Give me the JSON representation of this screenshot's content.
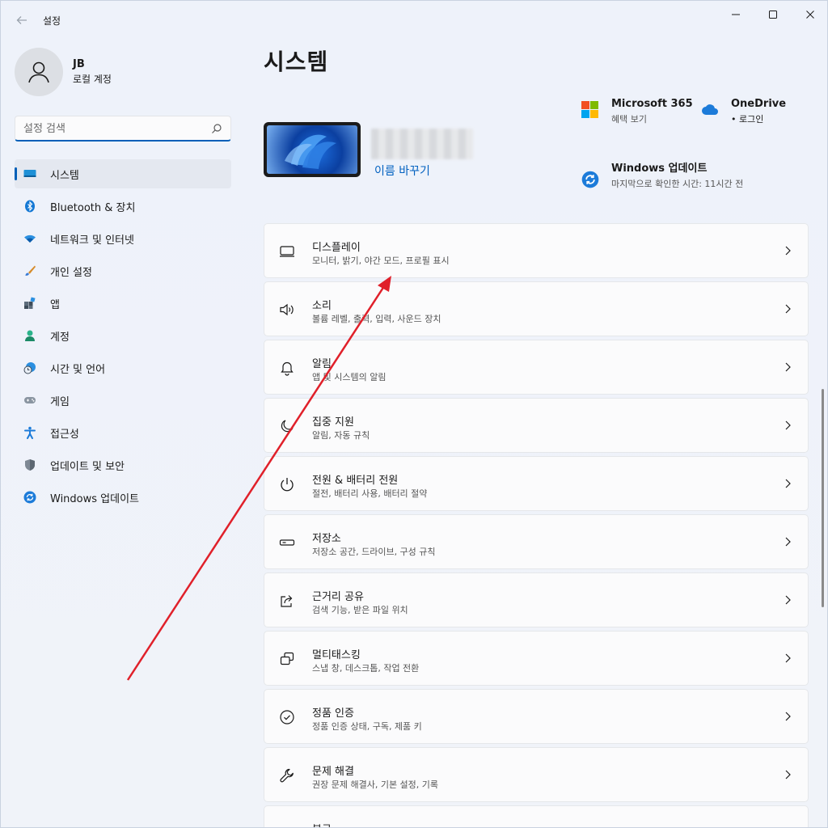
{
  "app": {
    "title": "설정"
  },
  "profile": {
    "name": "JB",
    "account_type": "로컬 계정"
  },
  "search": {
    "placeholder": "설정 검색"
  },
  "sidebar": {
    "items": [
      {
        "label": "시스템",
        "icon": "monitor-icon",
        "active": true
      },
      {
        "label": "Bluetooth & 장치",
        "icon": "bluetooth-icon"
      },
      {
        "label": "네트워크 및 인터넷",
        "icon": "wifi-icon"
      },
      {
        "label": "개인 설정",
        "icon": "brush-icon"
      },
      {
        "label": "앱",
        "icon": "apps-icon"
      },
      {
        "label": "계정",
        "icon": "person-icon"
      },
      {
        "label": "시간 및 언어",
        "icon": "clock-globe-icon"
      },
      {
        "label": "게임",
        "icon": "gamepad-icon"
      },
      {
        "label": "접근성",
        "icon": "accessibility-icon"
      },
      {
        "label": "업데이트 및 보안",
        "icon": "shield-icon"
      },
      {
        "label": "Windows 업데이트",
        "icon": "windows-update-icon"
      }
    ]
  },
  "main": {
    "title": "시스템",
    "rename_label": "이름 바꾸기",
    "quick": {
      "m365": {
        "title": "Microsoft 365",
        "sub": "혜택 보기"
      },
      "onedrive": {
        "title": "OneDrive",
        "sub": "• 로그인"
      },
      "update": {
        "title": "Windows 업데이트",
        "sub": "마지막으로 확인한 시간: 11시간 전"
      }
    },
    "cards": [
      {
        "title": "디스플레이",
        "sub": "모니터, 밝기, 야간 모드, 프로필 표시",
        "icon": "display-icon"
      },
      {
        "title": "소리",
        "sub": "볼륨 레벨, 출력, 입력, 사운드 장치",
        "icon": "speaker-icon"
      },
      {
        "title": "알림",
        "sub": "앱 및 시스템의 알림",
        "icon": "bell-icon"
      },
      {
        "title": "집중 지원",
        "sub": "알림, 자동 규칙",
        "icon": "moon-icon"
      },
      {
        "title": "전원 & 배터리 전원",
        "sub": "절전, 배터리 사용, 배터리 절약",
        "icon": "power-icon"
      },
      {
        "title": "저장소",
        "sub": "저장소 공간, 드라이브, 구성 규칙",
        "icon": "storage-icon"
      },
      {
        "title": "근거리 공유",
        "sub": "검색 기능, 받은 파일 위치",
        "icon": "share-icon"
      },
      {
        "title": "멀티태스킹",
        "sub": "스냅 창, 데스크톱, 작업 전환",
        "icon": "multitask-icon"
      },
      {
        "title": "정품 인증",
        "sub": "정품 인증 상태, 구독, 제품 키",
        "icon": "check-circle-icon"
      },
      {
        "title": "문제 해결",
        "sub": "권장 문제 해결사, 기본 설정, 기록",
        "icon": "wrench-icon"
      },
      {
        "title": "복구",
        "sub": "",
        "icon": "recovery-icon"
      }
    ]
  },
  "colors": {
    "accent": "#005fb8",
    "link": "#0060c0",
    "annotation_arrow": "#e0202a"
  }
}
